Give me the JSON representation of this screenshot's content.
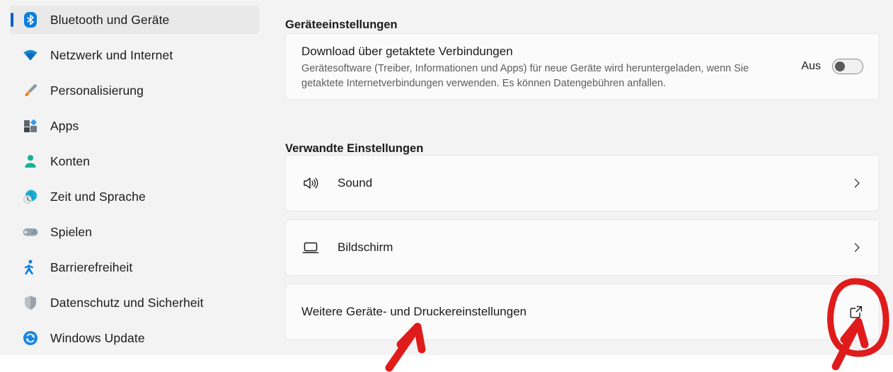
{
  "sidebar": {
    "items": [
      {
        "label": "Bluetooth und Geräte",
        "icon": "bluetooth-icon",
        "selected": true
      },
      {
        "label": "Netzwerk und Internet",
        "icon": "wifi-icon",
        "selected": false
      },
      {
        "label": "Personalisierung",
        "icon": "paintbrush-icon",
        "selected": false
      },
      {
        "label": "Apps",
        "icon": "apps-icon",
        "selected": false
      },
      {
        "label": "Konten",
        "icon": "account-icon",
        "selected": false
      },
      {
        "label": "Zeit und Sprache",
        "icon": "clock-globe-icon",
        "selected": false
      },
      {
        "label": "Spielen",
        "icon": "gamepad-icon",
        "selected": false
      },
      {
        "label": "Barrierefreiheit",
        "icon": "accessibility-icon",
        "selected": false
      },
      {
        "label": "Datenschutz und Sicherheit",
        "icon": "shield-icon",
        "selected": false
      },
      {
        "label": "Windows Update",
        "icon": "update-icon",
        "selected": false
      }
    ]
  },
  "main": {
    "device_settings": {
      "heading": "Geräteeinstellungen",
      "metered": {
        "title": "Download über getaktete Verbindungen",
        "description": "Gerätesoftware (Treiber, Informationen und Apps) für neue Geräte wird heruntergeladen, wenn Sie getaktete Internetverbindungen verwenden. Es können Datengebühren anfallen.",
        "toggle_state": "Aus",
        "toggle_on": false
      }
    },
    "related_settings": {
      "heading": "Verwandte Einstellungen",
      "rows": [
        {
          "label": "Sound",
          "icon": "speaker-icon",
          "affordance": "chevron-right-icon"
        },
        {
          "label": "Bildschirm",
          "icon": "monitor-icon",
          "affordance": "chevron-right-icon"
        },
        {
          "label": "Weitere Geräte- und Druckereinstellungen",
          "icon": null,
          "affordance": "external-link-icon"
        }
      ]
    }
  },
  "annotations": {
    "color": "#e01b1b",
    "highlight_circle_target": "external-link-icon",
    "arrow_to_circle": true,
    "arrow_to_label": true
  },
  "colors": {
    "accent": "#0a5ec9",
    "page_background": "#f3f3f3",
    "card_background": "#fbfbfb",
    "annotation_red": "#e01b1b"
  }
}
